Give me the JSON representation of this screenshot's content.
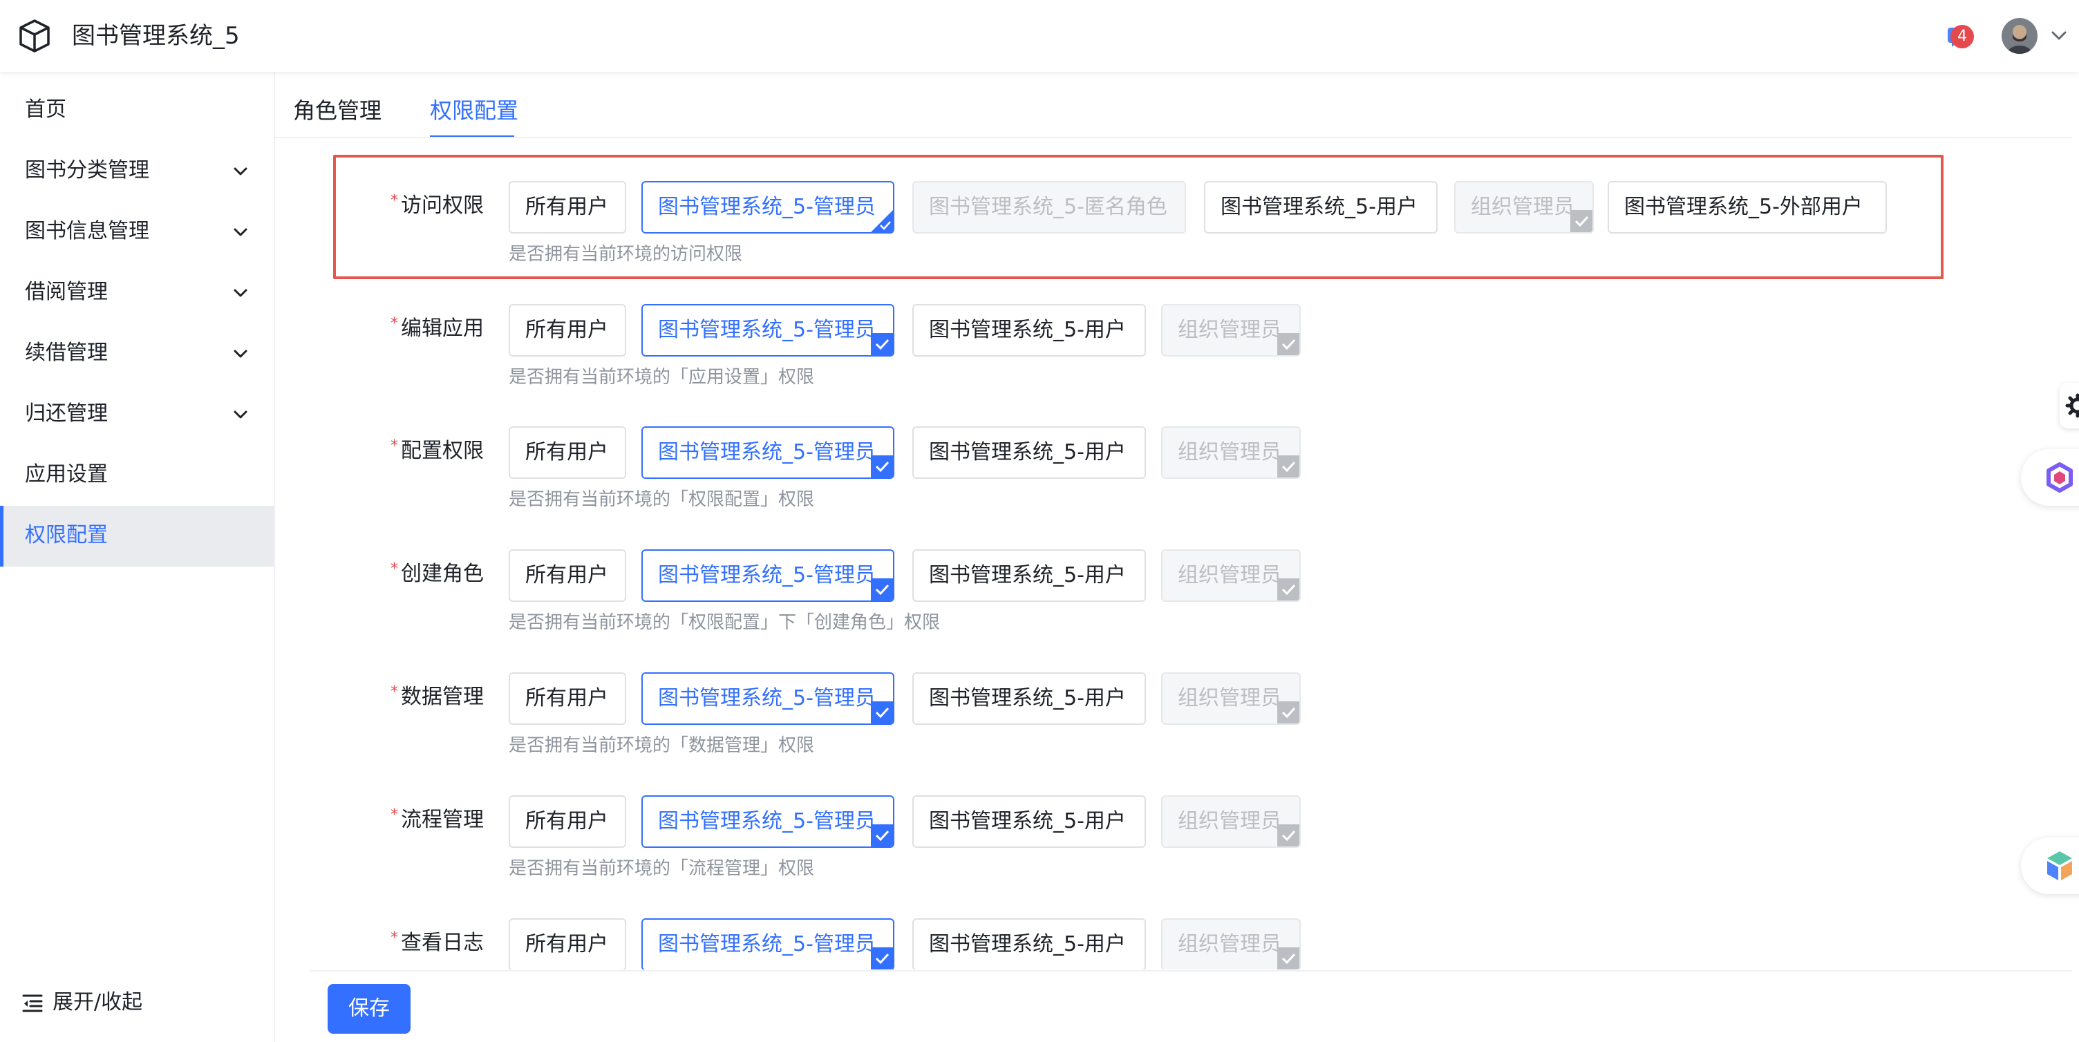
{
  "header": {
    "title": "图书管理系统_5",
    "logo_icon": "cube-icon",
    "notification_count": "4",
    "notification_icon": "message-icon",
    "user_icon": "chevron-down-icon"
  },
  "sidebar": {
    "items": [
      {
        "label": "首页",
        "expandable": false
      },
      {
        "label": "图书分类管理",
        "expandable": true
      },
      {
        "label": "图书信息管理",
        "expandable": true
      },
      {
        "label": "借阅管理",
        "expandable": true
      },
      {
        "label": "续借管理",
        "expandable": true
      },
      {
        "label": "归还管理",
        "expandable": true
      },
      {
        "label": "应用设置",
        "expandable": false
      },
      {
        "label": "权限配置",
        "expandable": false,
        "active": true
      }
    ],
    "collapse_label": "展开/收起"
  },
  "tabs": [
    {
      "label": "角色管理",
      "active": false
    },
    {
      "label": "权限配置",
      "active": true
    }
  ],
  "options": {
    "all_users": "所有用户",
    "admin": "图书管理系统_5-管理员",
    "anonymous": "图书管理系统_5-匿名角色",
    "user": "图书管理系统_5-用户",
    "org_admin": "组织管理员",
    "external": "图书管理系统_5-外部用户"
  },
  "permissions": [
    {
      "label": "访问权限",
      "desc": "是否拥有当前环境的访问权限"
    },
    {
      "label": "编辑应用",
      "desc": "是否拥有当前环境的「应用设置」权限"
    },
    {
      "label": "配置权限",
      "desc": "是否拥有当前环境的「权限配置」权限"
    },
    {
      "label": "创建角色",
      "desc": "是否拥有当前环境的「权限配置」下「创建角色」权限"
    },
    {
      "label": "数据管理",
      "desc": "是否拥有当前环境的「数据管理」权限"
    },
    {
      "label": "流程管理",
      "desc": "是否拥有当前环境的「流程管理」权限"
    },
    {
      "label": "查看日志",
      "desc": ""
    }
  ],
  "required_mark": "*",
  "footer": {
    "save_label": "保存"
  },
  "colors": {
    "primary": "#3370ff",
    "highlight_border": "#e4574c",
    "badge": "#e5484d",
    "disabled_text": "#bbbfc4"
  }
}
